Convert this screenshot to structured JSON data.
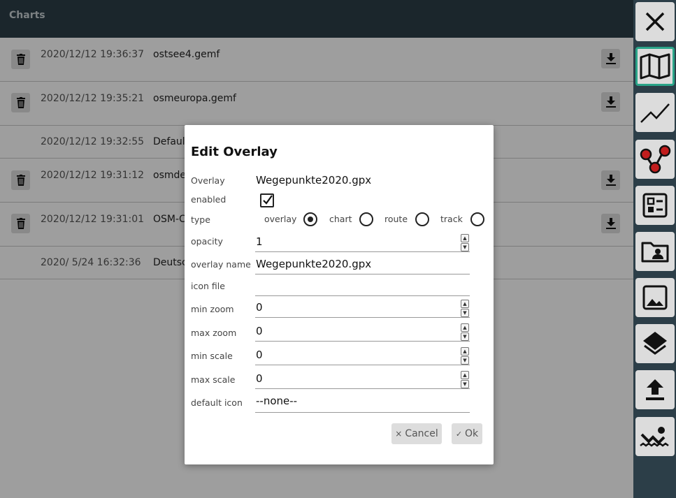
{
  "header": {
    "title": "Charts"
  },
  "charts": [
    {
      "date": "2020/12/12 19:36:37",
      "name": "ostsee4.gemf",
      "deletable": true,
      "downloadable": true
    },
    {
      "date": "2020/12/12 19:35:21",
      "name": "osmeuropa.gemf",
      "deletable": true,
      "downloadable": true
    },
    {
      "date": "2020/12/12 19:32:55",
      "name": "Defaul",
      "deletable": false,
      "downloadable": false
    },
    {
      "date": "2020/12/12 19:31:12",
      "name": "osmde",
      "deletable": true,
      "downloadable": true
    },
    {
      "date": "2020/12/12 19:31:01",
      "name": "OSM-C",
      "deletable": true,
      "downloadable": true
    },
    {
      "date": "2020/ 5/24 16:32:36",
      "name": "Deutsc",
      "deletable": false,
      "downloadable": false
    }
  ],
  "toolbar": {
    "buttons": [
      {
        "icon": "close-icon"
      },
      {
        "icon": "map-icon",
        "active": true
      },
      {
        "icon": "chart-line-icon"
      },
      {
        "icon": "route-nodes-icon"
      },
      {
        "icon": "checklist-icon"
      },
      {
        "icon": "user-folder-icon"
      },
      {
        "icon": "image-icon"
      },
      {
        "icon": "layers-icon"
      },
      {
        "icon": "upload-icon"
      },
      {
        "icon": "swimmer-icon"
      }
    ]
  },
  "dialog": {
    "title": "Edit Overlay",
    "overlay_label": "Overlay",
    "overlay_value": "Wegepunkte2020.gpx",
    "enabled_label": "enabled",
    "enabled": true,
    "type_label": "type",
    "type_options": [
      "overlay",
      "chart",
      "route",
      "track"
    ],
    "type_selected": "overlay",
    "opacity_label": "opacity",
    "opacity_value": "1",
    "overlay_name_label": "overlay name",
    "overlay_name_value": "Wegepunkte2020.gpx",
    "icon_file_label": "icon file",
    "icon_file_value": "",
    "min_zoom_label": "min zoom",
    "min_zoom_value": "0",
    "max_zoom_label": "max zoom",
    "max_zoom_value": "0",
    "min_scale_label": "min scale",
    "min_scale_value": "0",
    "max_scale_label": "max scale",
    "max_scale_value": "0",
    "default_icon_label": "default icon",
    "default_icon_value": "--none--",
    "cancel_label": "Cancel",
    "ok_label": "Ok"
  }
}
